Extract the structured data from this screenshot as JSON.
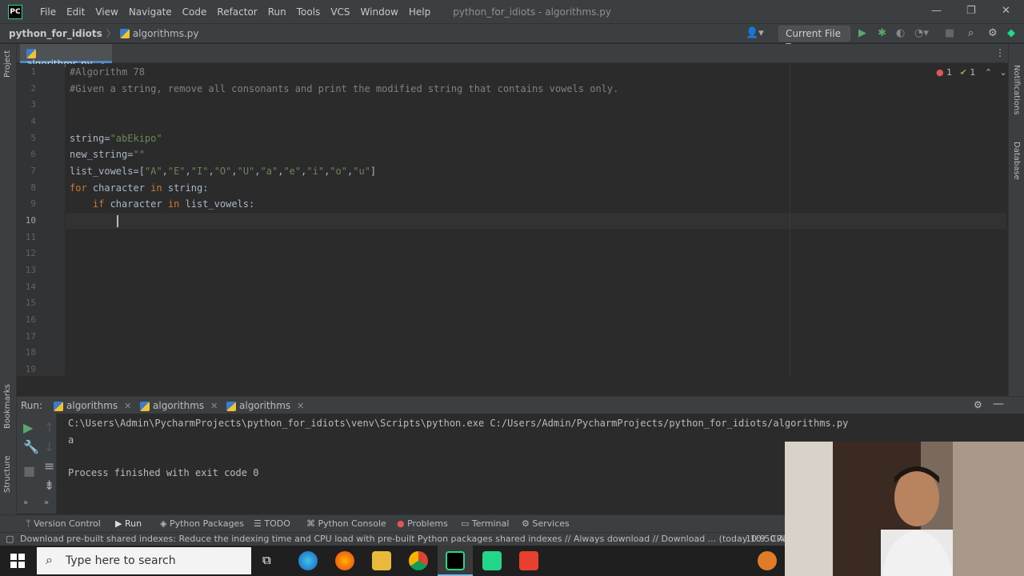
{
  "menubar": {
    "logo": "PC",
    "items": [
      "File",
      "Edit",
      "View",
      "Navigate",
      "Code",
      "Refactor",
      "Run",
      "Tools",
      "VCS",
      "Window",
      "Help"
    ],
    "title": "python_for_idiots - algorithms.py"
  },
  "navbar": {
    "project": "python_for_idiots",
    "file": "algorithms.py",
    "run_config": "Current File"
  },
  "side_labels": {
    "project": "Project",
    "bookmarks": "Bookmarks",
    "structure": "Structure",
    "notifications": "Notifications",
    "database": "Database"
  },
  "editor": {
    "tab_label": "algorithms.py",
    "inspections": {
      "errors": "1",
      "ok": "1"
    },
    "line_numbers": [
      "1",
      "2",
      "3",
      "4",
      "5",
      "6",
      "7",
      "8",
      "9",
      "10",
      "11",
      "12",
      "13",
      "14",
      "15",
      "16",
      "17",
      "18",
      "19"
    ],
    "lines": [
      "#Algorithm 78",
      "#Given a string, remove all consonants and print the modified string that contains vowels only.",
      "",
      "",
      "string=\"abEkipo\"",
      "new_string=\"\"",
      "list_vowels=[\"A\",\"E\",\"I\",\"O\",\"U\",\"a\",\"e\",\"i\",\"o\",\"u\"]",
      "for character in string:",
      "    if character in list_vowels:",
      ""
    ],
    "current_line": "10"
  },
  "run_panel": {
    "label": "Run:",
    "tabs": [
      "algorithms",
      "algorithms",
      "algorithms"
    ],
    "console": [
      "C:\\Users\\Admin\\PycharmProjects\\python_for_idiots\\venv\\Scripts\\python.exe C:/Users/Admin/PycharmProjects/python_for_idiots/algorithms.py",
      "a",
      "",
      "Process finished with exit code 0"
    ]
  },
  "tool_windows": [
    "Version Control",
    "Run",
    "Python Packages",
    "TODO",
    "Python Console",
    "Problems",
    "Terminal",
    "Services"
  ],
  "status": {
    "message": "Download pre-built shared indexes: Reduce the indexing time and CPU load with pre-built Python packages shared indexes // Always download // Download ... (today 10:50 AM)",
    "position": "10:9",
    "line_sep": "CRL"
  },
  "taskbar": {
    "search_placeholder": "Type here to search"
  },
  "colors": {
    "accent": "#4a88c7",
    "keyword": "#cc7832",
    "string": "#6a8759",
    "comment": "#808080"
  }
}
